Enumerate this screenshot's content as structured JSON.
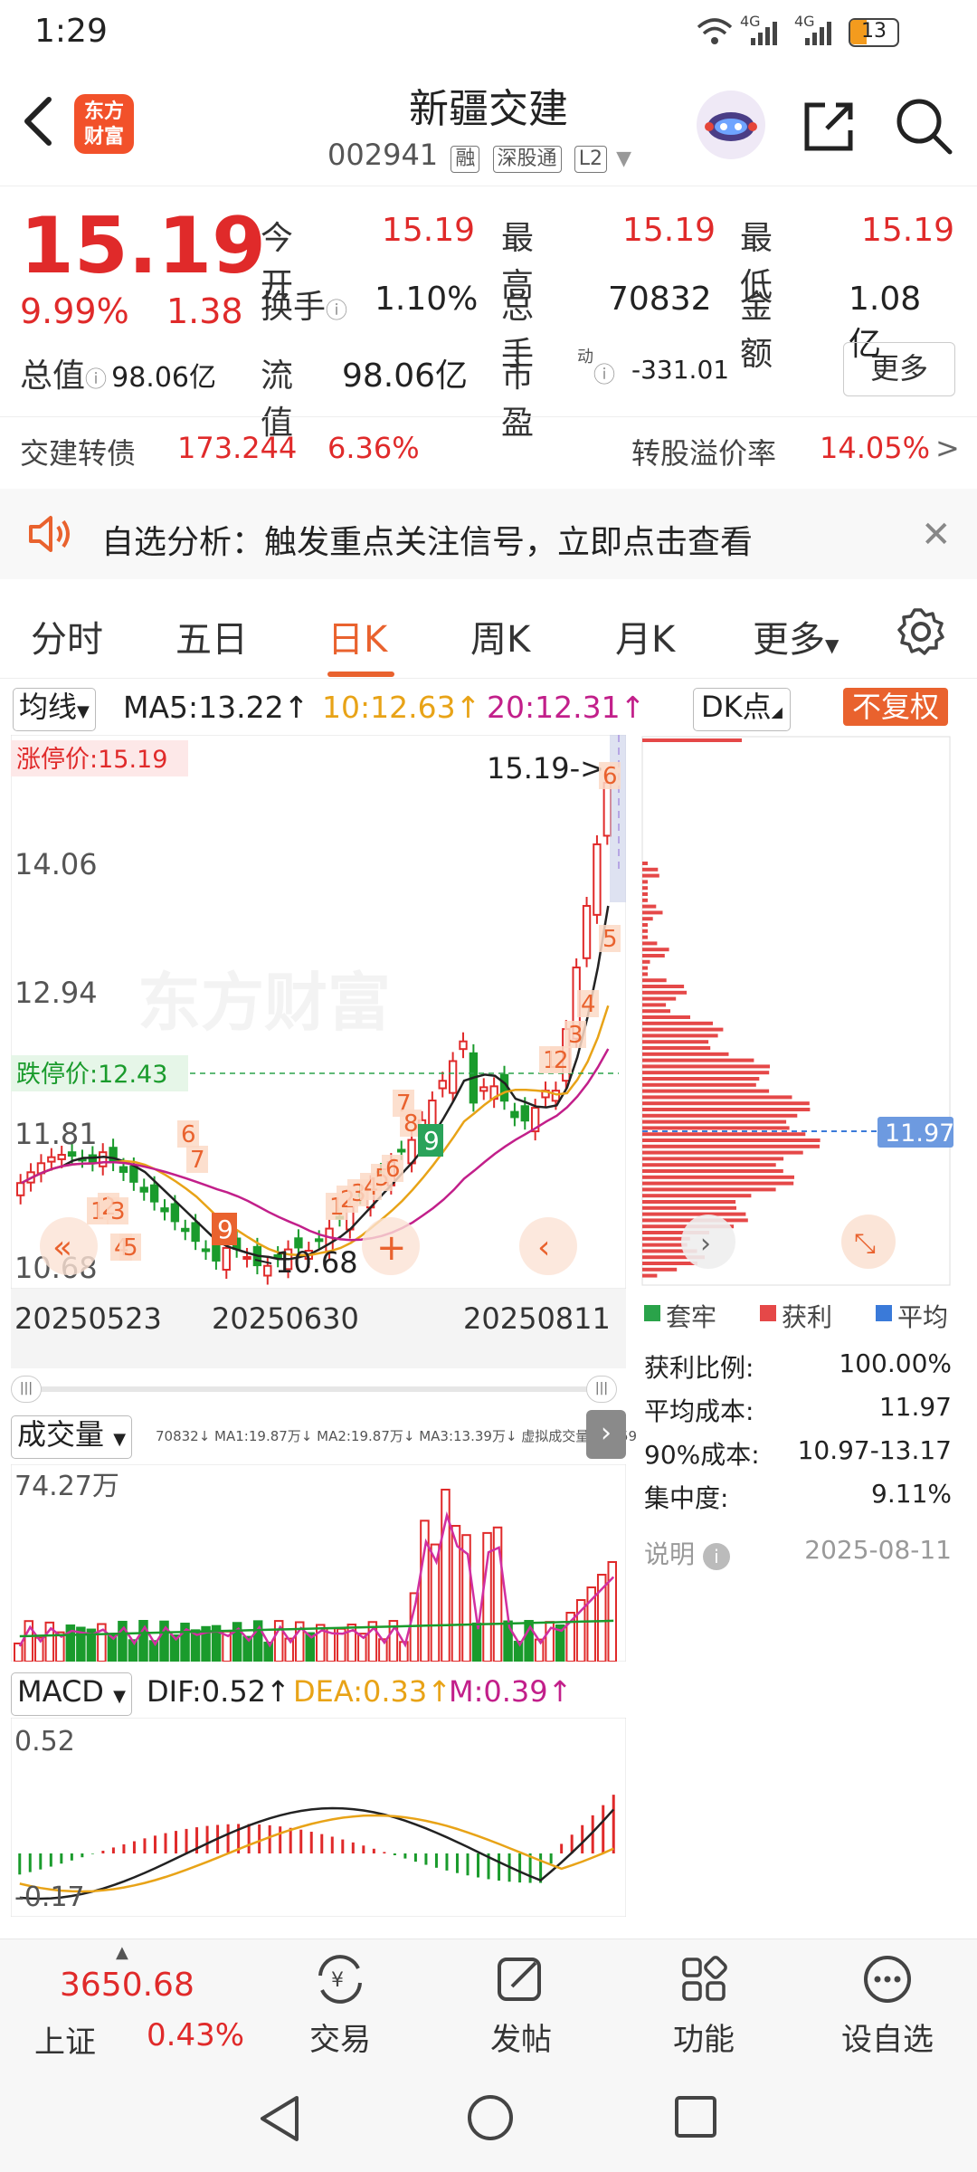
{
  "status_bar": {
    "time": "1:29",
    "network": "4G",
    "battery": "13"
  },
  "header": {
    "logo_text": "东方\n财富",
    "stock_name": "新疆交建",
    "stock_code": "002941",
    "tags": [
      "融",
      "深股通",
      "L2"
    ]
  },
  "quote": {
    "price": "15.19",
    "change_pct": "9.99%",
    "change_amt": "1.38",
    "total_value_label": "总值",
    "total_value": "98.06亿",
    "open_label": "今开",
    "open": "15.19",
    "high_label": "最高",
    "high": "15.19",
    "low_label": "最低",
    "low": "15.19",
    "turnover_label": "换手",
    "turnover": "1.10%",
    "volume_label": "总手",
    "volume": "70832",
    "amount_label": "金额",
    "amount": "1.08亿",
    "float_label": "流值",
    "float_value": "98.06亿",
    "pe_label": "市盈",
    "pe_sup": "动",
    "pe": "-331.01",
    "more_label": "更多"
  },
  "bond": {
    "name": "交建转债",
    "price": "173.244",
    "pct": "6.36%",
    "premium_label": "转股溢价率",
    "premium": "14.05%"
  },
  "notice": {
    "text": "自选分析：触发重点关注信号，立即点击查看"
  },
  "tabs": [
    "分时",
    "五日",
    "日K",
    "周K",
    "月K",
    "更多"
  ],
  "active_tab": "日K",
  "ma_bar": {
    "selector": "均线",
    "ma5": "MA5:13.22",
    "ma10": "10:12.63",
    "ma20": "20:12.31",
    "dk_label": "DK点",
    "adjust_label": "不复权"
  },
  "kline": {
    "limit_up_label": "涨停价:15.19",
    "limit_down_label": "跌停价:12.43",
    "axis_labels": [
      "14.06",
      "12.94",
      "11.81",
      "10.68"
    ],
    "current_price_marker": "15.19->",
    "low_marker": "10.68",
    "dates": [
      "20250523",
      "20250630",
      "20250811"
    ],
    "watermark": "东方财富"
  },
  "chip": {
    "avg_marker": "11.97",
    "legend": [
      "套牢",
      "获利",
      "平均"
    ],
    "rows": [
      {
        "label": "获利比例:",
        "value": "100.00%"
      },
      {
        "label": "平均成本:",
        "value": "11.97"
      },
      {
        "label": "90%成本:",
        "value": "10.97-13.17"
      },
      {
        "label": "集中度:",
        "value": "9.11%"
      }
    ],
    "note_label": "说明",
    "note_date": "2025-08-11"
  },
  "volume_panel": {
    "selector": "成交量",
    "info": "70832↓ MA1:19.87万↓ MA2:19.87万↓ MA3:13.39万↓ 虚拟成交量:75959",
    "max_label": "74.27万"
  },
  "macd_panel": {
    "selector": "MACD",
    "dif": "DIF:0.52",
    "dea": "DEA:0.33",
    "m": "M:0.39",
    "top_label": "0.52",
    "bottom_label": "-0.17"
  },
  "bottom_bar": {
    "index_value": "3650.68",
    "index_name": "上证",
    "index_pct": "0.43%",
    "items": [
      "交易",
      "发帖",
      "功能",
      "设自选"
    ]
  },
  "colors": {
    "up": "#e02a2a",
    "down": "#1a9b2c",
    "accent": "#e9622e",
    "ma10": "#e8a317",
    "ma20": "#c21f8a"
  }
}
